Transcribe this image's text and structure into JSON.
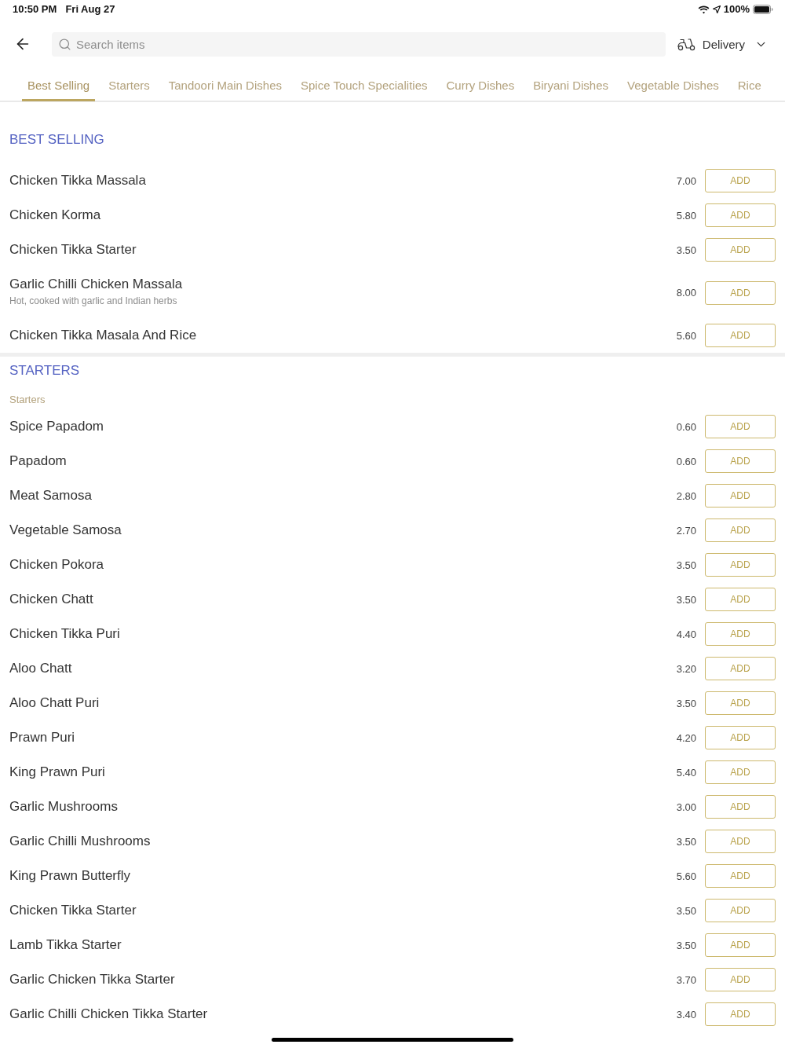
{
  "status_bar": {
    "time": "10:50 PM",
    "date": "Fri Aug 27",
    "battery": "100%"
  },
  "header": {
    "search": {
      "placeholder": "Search items"
    },
    "order_mode": "Delivery"
  },
  "tabs": [
    {
      "label": "Best Selling",
      "selected": true
    },
    {
      "label": "Starters",
      "selected": false
    },
    {
      "label": "Tandoori Main Dishes",
      "selected": false
    },
    {
      "label": "Spice Touch Specialities",
      "selected": false
    },
    {
      "label": "Curry Dishes",
      "selected": false
    },
    {
      "label": "Biryani Dishes",
      "selected": false
    },
    {
      "label": "Vegetable Dishes",
      "selected": false
    },
    {
      "label": "Rice",
      "selected": false
    }
  ],
  "sections": [
    {
      "title": "BEST SELLING",
      "items": [
        {
          "name": "Chicken Tikka Massala",
          "price": "7.00",
          "action": "ADD"
        },
        {
          "name": "Chicken Korma",
          "price": "5.80",
          "action": "ADD"
        },
        {
          "name": "Chicken Tikka Starter",
          "price": "3.50",
          "action": "ADD"
        },
        {
          "name": "Garlic Chilli Chicken Massala",
          "description": "Hot, cooked with garlic and Indian herbs",
          "price": "8.00",
          "action": "ADD"
        },
        {
          "name": "Chicken Tikka Masala And Rice",
          "price": "5.60",
          "action": "ADD"
        }
      ]
    },
    {
      "title": "STARTERS",
      "subtitle": "Starters",
      "items": [
        {
          "name": "Spice Papadom",
          "price": "0.60",
          "action": "ADD"
        },
        {
          "name": "Papadom",
          "price": "0.60",
          "action": "ADD"
        },
        {
          "name": "Meat Samosa",
          "price": "2.80",
          "action": "ADD"
        },
        {
          "name": "Vegetable Samosa",
          "price": "2.70",
          "action": "ADD"
        },
        {
          "name": "Chicken Pokora",
          "price": "3.50",
          "action": "ADD"
        },
        {
          "name": "Chicken Chatt",
          "price": "3.50",
          "action": "ADD"
        },
        {
          "name": "Chicken Tikka Puri",
          "price": "4.40",
          "action": "ADD"
        },
        {
          "name": "Aloo Chatt",
          "price": "3.20",
          "action": "ADD"
        },
        {
          "name": "Aloo Chatt Puri",
          "price": "3.50",
          "action": "ADD"
        },
        {
          "name": "Prawn Puri",
          "price": "4.20",
          "action": "ADD"
        },
        {
          "name": "King Prawn Puri",
          "price": "5.40",
          "action": "ADD"
        },
        {
          "name": "Garlic Mushrooms",
          "price": "3.00",
          "action": "ADD"
        },
        {
          "name": "Garlic Chilli Mushrooms",
          "price": "3.50",
          "action": "ADD"
        },
        {
          "name": "King Prawn Butterfly",
          "price": "5.60",
          "action": "ADD"
        },
        {
          "name": "Chicken Tikka Starter",
          "price": "3.50",
          "action": "ADD"
        },
        {
          "name": "Lamb Tikka Starter",
          "price": "3.50",
          "action": "ADD"
        },
        {
          "name": "Garlic Chicken Tikka Starter",
          "price": "3.70",
          "action": "ADD"
        },
        {
          "name": "Garlic Chilli Chicken Tikka Starter",
          "price": "3.40",
          "action": "ADD"
        }
      ]
    }
  ]
}
